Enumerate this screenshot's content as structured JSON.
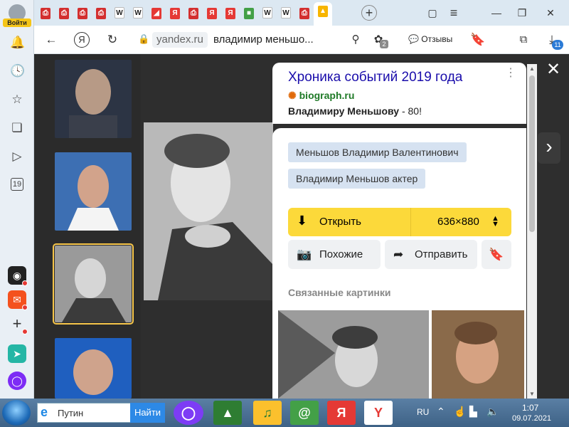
{
  "sidebar": {
    "login_label": "Войти",
    "calendar_day": "19"
  },
  "tabs": {
    "items": [
      {
        "kind": "pdf",
        "color": "#d32f2f",
        "glyph": "PDF"
      },
      {
        "kind": "pdf",
        "color": "#d32f2f",
        "glyph": "PDF"
      },
      {
        "kind": "pdf",
        "color": "#d32f2f",
        "glyph": "PDF"
      },
      {
        "kind": "pdf",
        "color": "#d32f2f",
        "glyph": "PDF"
      },
      {
        "kind": "wiki",
        "color": "#222222",
        "glyph": "W"
      },
      {
        "kind": "wiki",
        "color": "#222222",
        "glyph": "W"
      },
      {
        "kind": "slides",
        "color": "#e53935",
        "glyph": "◢"
      },
      {
        "kind": "yandex",
        "color": "#e53935",
        "glyph": "Я"
      },
      {
        "kind": "pdf",
        "color": "#d32f2f",
        "glyph": "PDF"
      },
      {
        "kind": "yandex",
        "color": "#e53935",
        "glyph": "Я"
      },
      {
        "kind": "yandex",
        "color": "#e53935",
        "glyph": "Я"
      },
      {
        "kind": "puzzle",
        "color": "#43a047",
        "glyph": "■"
      },
      {
        "kind": "wiki",
        "color": "#222222",
        "glyph": "W"
      },
      {
        "kind": "wiki",
        "color": "#222222",
        "glyph": "W"
      },
      {
        "kind": "pdf",
        "color": "#d32f2f",
        "glyph": "PDF"
      },
      {
        "kind": "images",
        "color": "#f7b500",
        "glyph": "▲"
      }
    ],
    "new_tab_label": "+"
  },
  "toolbar": {
    "domain": "yandex.ru",
    "query": "владимир меньшо...",
    "reviews_label": "Отзывы",
    "extensions_badge": "2",
    "downloads_badge": "11"
  },
  "result": {
    "title": "Хроника событий 2019 года",
    "domain": "biograph.ru",
    "snippet_bold": "Владимиру Меньшову",
    "snippet_rest": " - 80!",
    "tags": [
      "Меньшов Владимир Валентинович",
      "Владимир Меньшов актер"
    ],
    "open_label": "Открыть",
    "size_label": "636×880",
    "similar_label": "Похожие",
    "share_label": "Отправить",
    "related_label": "Связанные картинки"
  },
  "overlay": {
    "close_glyph": "✕",
    "next_glyph": "›"
  },
  "taskbar": {
    "search_value": "Путин",
    "search_button": "Найти",
    "lang": "RU",
    "time": "1:07",
    "date": "09.07.2021"
  },
  "colors": {
    "accent_yellow": "#fcd93a",
    "link_blue": "#1a0dab",
    "domain_green": "#1f7a27",
    "tag_bg": "#d6e2f1"
  }
}
